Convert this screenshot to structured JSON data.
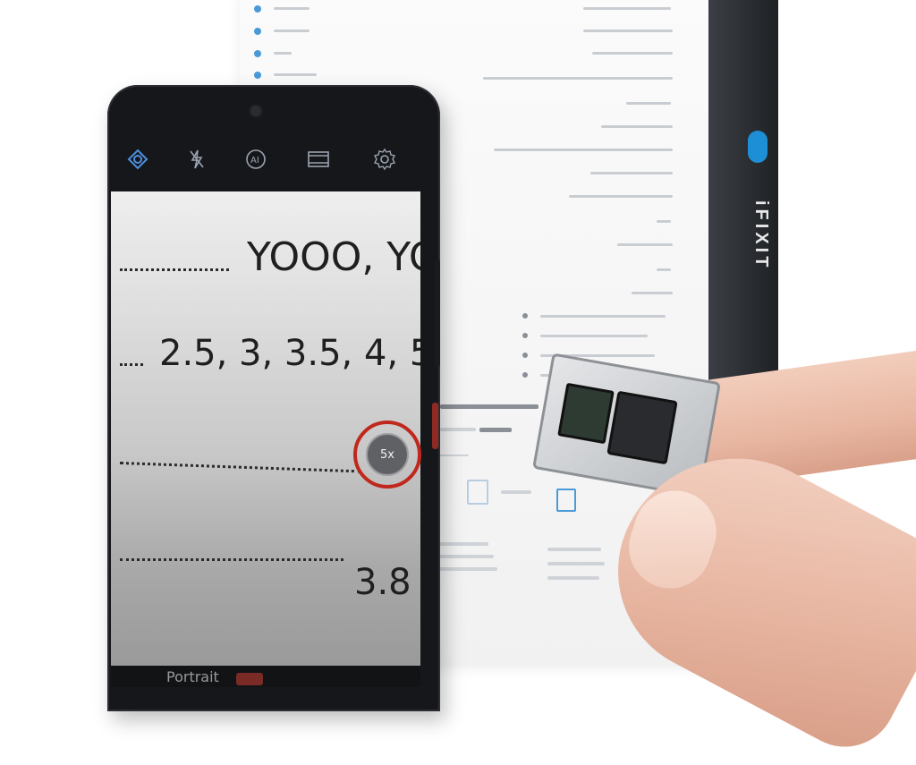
{
  "phone": {
    "camera_top_icons": [
      "camera-filter-icon",
      "flash-off-icon",
      "ai-mode-icon",
      "video-aspect-icon",
      "settings-gear-icon"
    ],
    "viewfinder_lines": [
      "YOOO, YO",
      "2.5, 3, 3.5, 4, 5",
      "3.8"
    ],
    "zoom_label": "5x",
    "camera_mode": "Portrait"
  },
  "box": {
    "brand_logo_text": "iFIXIT"
  },
  "colors": {
    "zoom_highlight_ring": "#c0281d",
    "icon_accent": "#4d8fe0"
  }
}
